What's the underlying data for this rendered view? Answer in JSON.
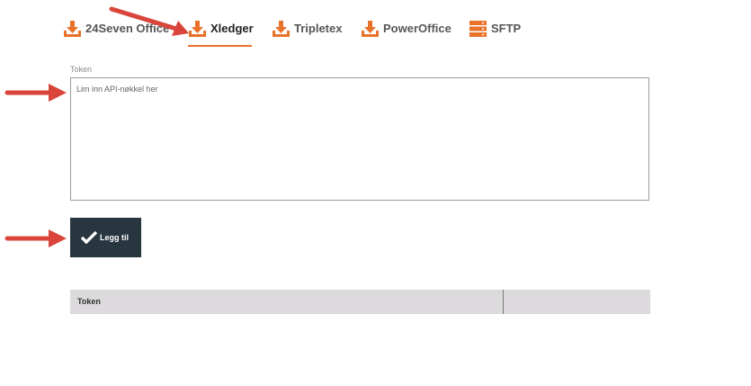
{
  "tabs": [
    {
      "label": "24Seven Office",
      "icon": "download-icon",
      "active": false
    },
    {
      "label": "Xledger",
      "icon": "download-icon",
      "active": true
    },
    {
      "label": "Tripletex",
      "icon": "download-icon",
      "active": false
    },
    {
      "label": "PowerOffice",
      "icon": "download-icon",
      "active": false
    },
    {
      "label": "SFTP",
      "icon": "server-icon",
      "active": false
    }
  ],
  "form": {
    "token_label": "Token",
    "token_placeholder": "Lim inn API-nøkkel her",
    "token_value": "",
    "add_button_label": "Legg til"
  },
  "table": {
    "columns": [
      "Token",
      ""
    ]
  },
  "colors": {
    "accent": "#e8722a",
    "button_bg": "#283640",
    "annotation_arrow": "#d9453a",
    "table_header_bg": "#dcdadc"
  }
}
